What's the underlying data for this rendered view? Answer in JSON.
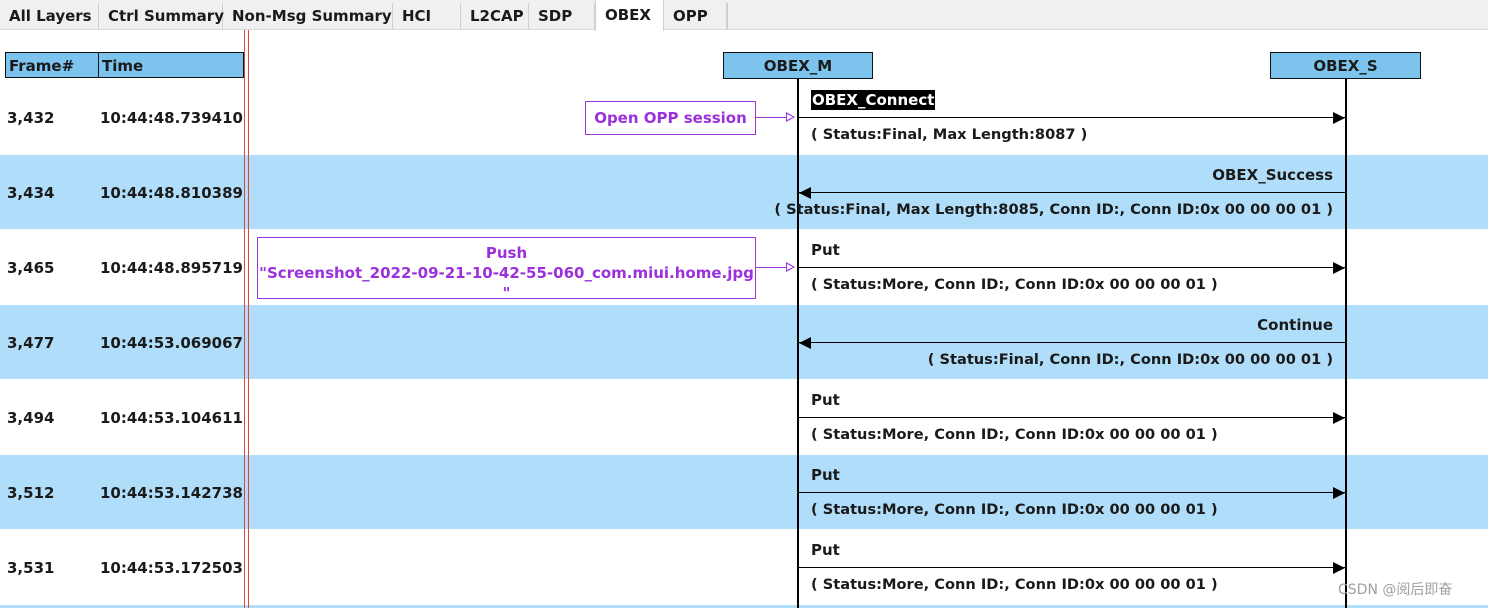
{
  "tabs": [
    "All Layers",
    "Ctrl Summary",
    "Non-Msg Summary",
    "HCI",
    "L2CAP",
    "SDP",
    "OBEX",
    "OPP"
  ],
  "active_tab": "OBEX",
  "columns": {
    "frame": "Frame#",
    "time": "Time"
  },
  "lifelines": {
    "left": "OBEX_M",
    "right": "OBEX_S"
  },
  "rows": [
    {
      "frame": "3,432",
      "time": "10:44:48.739410",
      "msg": "OBEX_Connect",
      "params": "( Status:Final, Max Length:8087 )",
      "direction": "to_right"
    },
    {
      "frame": "3,434",
      "time": "10:44:48.810389",
      "msg": "OBEX_Success",
      "params": "( Status:Final, Max Length:8085, Conn ID:, Conn ID:0x 00 00 00 01 )",
      "direction": "to_left"
    },
    {
      "frame": "3,465",
      "time": "10:44:48.895719",
      "msg": "Put",
      "params": "( Status:More, Conn ID:, Conn ID:0x 00 00 00 01 )",
      "direction": "to_right"
    },
    {
      "frame": "3,477",
      "time": "10:44:53.069067",
      "msg": "Continue",
      "params": "( Status:Final, Conn ID:, Conn ID:0x 00 00 00 01 )",
      "direction": "to_left"
    },
    {
      "frame": "3,494",
      "time": "10:44:53.104611",
      "msg": "Put",
      "params": "( Status:More, Conn ID:, Conn ID:0x 00 00 00 01 )",
      "direction": "to_right"
    },
    {
      "frame": "3,512",
      "time": "10:44:53.142738",
      "msg": "Put",
      "params": "( Status:More, Conn ID:, Conn ID:0x 00 00 00 01 )",
      "direction": "to_right"
    },
    {
      "frame": "3,531",
      "time": "10:44:53.172503",
      "msg": "Put",
      "params": "( Status:More, Conn ID:, Conn ID:0x 00 00 00 01 )",
      "direction": "to_right"
    }
  ],
  "notes": {
    "open_session": "Open OPP session",
    "push_title": "Push",
    "push_file": "\"Screenshot_2022-09-21-10-42-55-060_com.miui.home.jpg \""
  },
  "watermark": "CSDN @阅后即奋",
  "colors": {
    "row_band": "#b0defa",
    "header": "#7cc4ee",
    "note": "#9b30dd",
    "separator": "#e2463a"
  }
}
